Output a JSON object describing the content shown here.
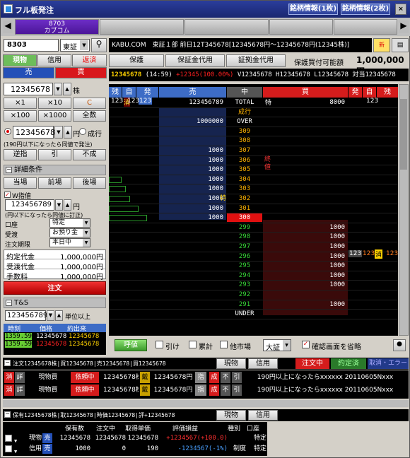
{
  "window": {
    "title": "フル板発注",
    "btn1": "銘柄情報(1枚)",
    "btn2": "銘柄情報(2枚)"
  },
  "tabs": {
    "active_code": "8703",
    "active_name": "カブコム"
  },
  "toolbar": {
    "symbol": "8303",
    "market": "東証",
    "info": "KABU.COM　東証１部 前日12T345678[12345678円〜12345678円(12345株)]"
  },
  "order_type_tabs": [
    "現物",
    "信用",
    "返済"
  ],
  "side_tabs": {
    "sell": "売",
    "buy": "買"
  },
  "qty": {
    "value": "12345678",
    "unit": "株"
  },
  "qty_buttons": [
    "×1",
    "×10",
    "C",
    "×100",
    "×1000",
    "全数"
  ],
  "price": {
    "value": "12345678",
    "unit": "円",
    "market_label": "成行"
  },
  "price_note": "(190円以下になったら同値で発注)",
  "cond_buttons": [
    "逆指",
    "引",
    "不成"
  ],
  "detail": {
    "title": "詳細条件",
    "tabs": [
      "当場",
      "前場",
      "後場"
    ],
    "stop_label": "W指値",
    "stop_value": "123456789",
    "stop_unit": "円",
    "stop_note": "(円以下になったら同値に訂正)"
  },
  "account": [
    {
      "label": "口座",
      "value": "特定"
    },
    {
      "label": "受渡",
      "value": "お預り金"
    },
    {
      "label": "注文期限",
      "value": "本日中"
    }
  ],
  "amounts": [
    {
      "label": "約定代金",
      "value": "1,000,000円"
    },
    {
      "label": "受渡代金",
      "value": "1,000,000円"
    },
    {
      "label": "手数料",
      "value": "1,000,000円"
    }
  ],
  "order_button": "注文",
  "ts": {
    "title": "T&S",
    "filter_value": "123456789",
    "filter_unit": "単位以上",
    "headers": [
      "時刻",
      "価格",
      "約出来"
    ],
    "rows": [
      [
        "1359.59",
        "12345678",
        "12345678"
      ],
      [
        "1359.59",
        "12345678",
        "12345678"
      ]
    ]
  },
  "info_tabs": [
    "保護",
    "保証金代用",
    "証拠金代用"
  ],
  "buying_power": {
    "label": "保護買付可能額",
    "value": "1,000,000円"
  },
  "quote_line": {
    "code": "12345678",
    "time": "(14:59)",
    "change": "+12345(100.00%)",
    "v": "V12345678",
    "h": "H12345678",
    "l": "L12345678",
    "m": "対当12345678"
  },
  "board_headers": [
    "残",
    "自",
    "発",
    "売",
    "中",
    "買",
    "発",
    "自",
    "残"
  ],
  "board": [
    {
      "sz": "",
      "ask": "123456789",
      "price": "TOTAL",
      "bid": "8000",
      "ask_col": "123",
      "first": "123",
      "flag": "消",
      "self": "123",
      "bid_flag": "特",
      "bid_self": "123"
    },
    {
      "price": "成行"
    },
    {
      "ask": "1000000",
      "price": "OVER"
    },
    {
      "price": "309"
    },
    {
      "price": "308"
    },
    {
      "ask": "1000",
      "price": "307"
    },
    {
      "ask": "1000",
      "price": "306",
      "note": "終値"
    },
    {
      "ask": "1000",
      "price": "305"
    },
    {
      "ask": "1000",
      "price": "304"
    },
    {
      "ask": "1000",
      "price": "303"
    },
    {
      "ask": "1000",
      "price": "302",
      "mark": "特"
    },
    {
      "ask": "1000",
      "price": "301"
    },
    {
      "ask": "1000",
      "price": "300"
    },
    {
      "price": "299",
      "bid": "1000"
    },
    {
      "price": "298",
      "bid": "1000"
    },
    {
      "price": "297",
      "bid": "1000"
    },
    {
      "price": "296",
      "bid": "1000"
    },
    {
      "price": "295",
      "bid": "1000"
    },
    {
      "price": "294",
      "bid": "1000"
    },
    {
      "price": "293",
      "bid": "1000"
    },
    {
      "price": "292"
    },
    {
      "price": "291",
      "bid": "1000"
    },
    {
      "price": "UNDER",
      "bid": ""
    }
  ],
  "board_row_extra": {
    "bid_self": "123",
    "bid_self2": "123",
    "flag": "消",
    "right": "123"
  },
  "board_footer": {
    "quote_btn": "呼値",
    "cb1": "引け",
    "cb2": "累計",
    "cb3": "他市場",
    "market": "大証",
    "cb4": "確認画面を省略"
  },
  "order_bar": {
    "summary": "注文12345678株|買12345678|売12345678|買12345678",
    "tab1": "現物",
    "tab2": "信用",
    "status1": "注文中",
    "status2": "約定済",
    "status3": "取消・エラー"
  },
  "orders": [
    {
      "c1": "消",
      "c2": "詳",
      "type": "現物買",
      "status": "依頼中",
      "qty": "12345678株",
      "tag": "戴",
      "price": "12345678円",
      "p": "指",
      "r1": "成",
      "r2": "不",
      "r3": "引",
      "cond": "190円以上になったらxxxxxx 20110605Nxxx"
    },
    {
      "c1": "消",
      "c2": "詳",
      "type": "現物買",
      "status": "依頼中",
      "qty": "12345678株",
      "tag": "戴",
      "price": "12345678円",
      "p": "指",
      "r1": "成",
      "r2": "不",
      "r3": "引",
      "cond": "190円以上になったらxxxxxx 20110605Nxxx"
    }
  ],
  "pos_bar": {
    "summary": "保有12345678株|取12345678|時価12345678|評+12345678",
    "tab1": "現物",
    "tab2": "信用"
  },
  "pos_headers": [
    "保有数",
    "注文中",
    "取得単価",
    "評価損益",
    "種別",
    "口座"
  ],
  "positions": [
    {
      "kind": "現物",
      "side": "売",
      "held": "12345678",
      "ordering": "12345678",
      "cost": "12345678",
      "pl": "+1234567(+100.0)",
      "class": "",
      "acct": "特定"
    },
    {
      "kind": "信用",
      "side": "売",
      "held": "1000",
      "ordering": "0",
      "cost": "190",
      "pl": "-1234567(-1%)",
      "class": "制度",
      "acct": "特定"
    }
  ]
}
